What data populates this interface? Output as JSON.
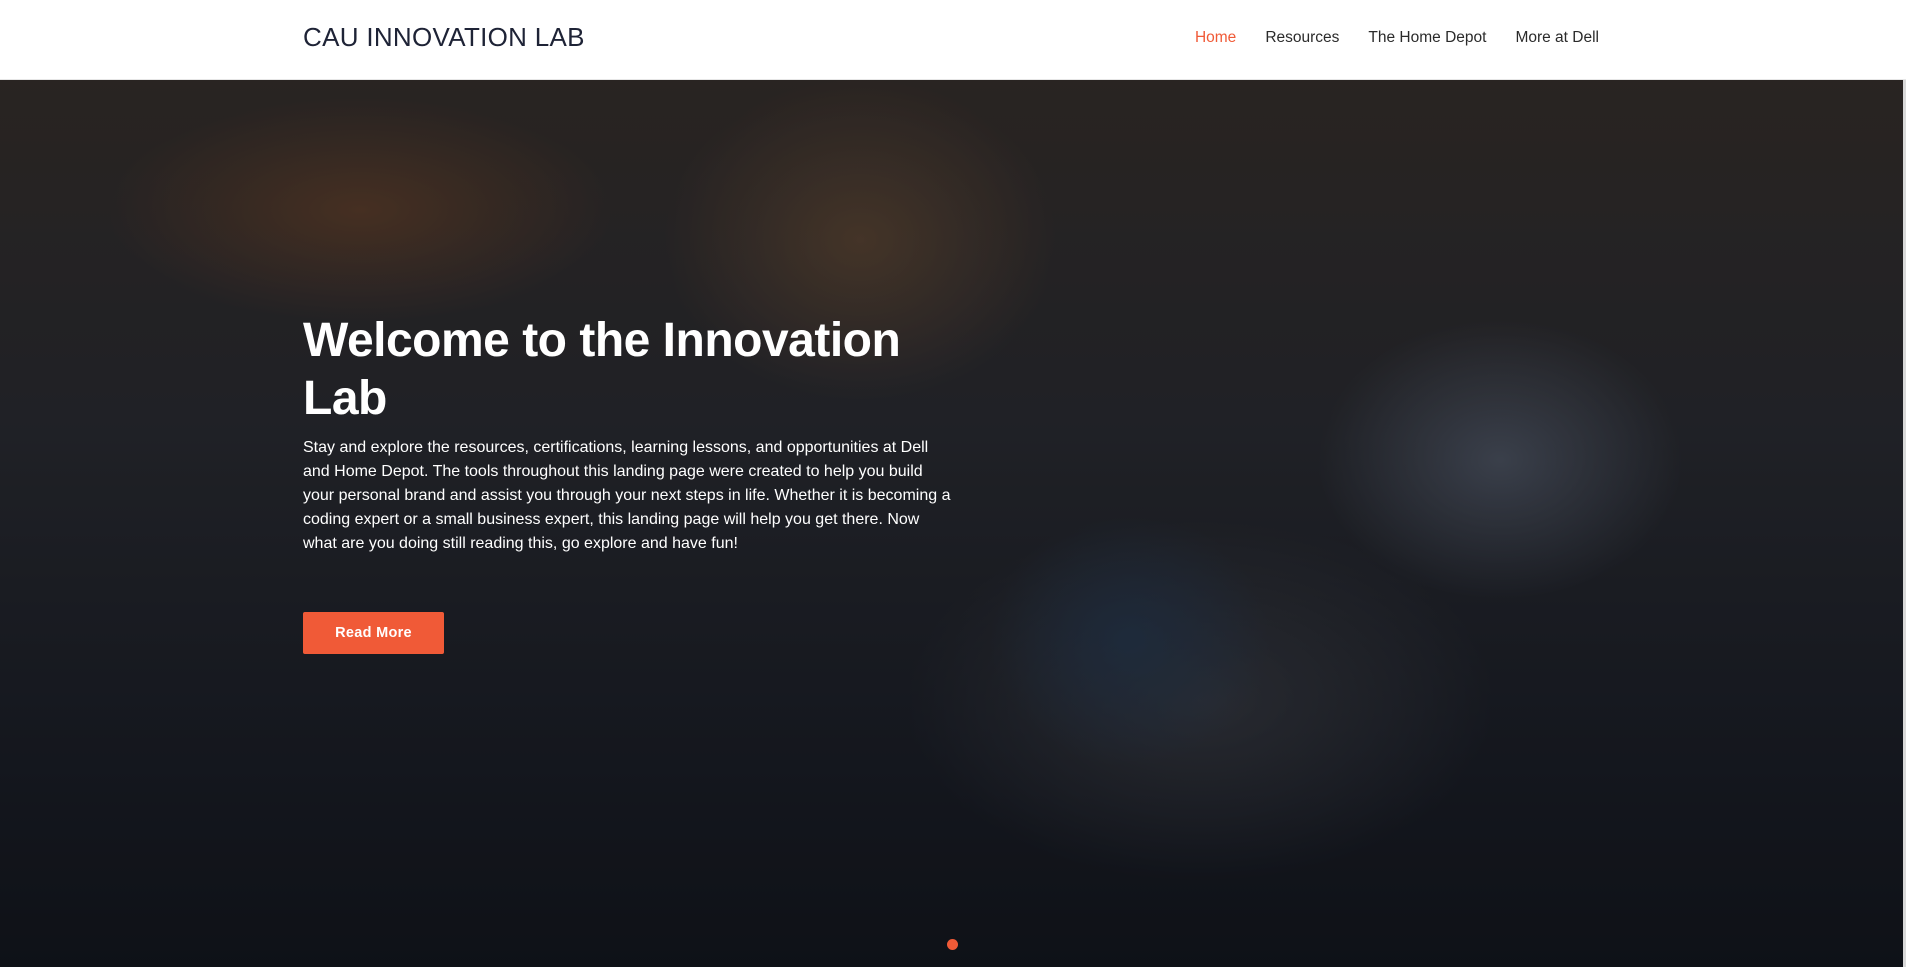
{
  "header": {
    "brand": "CAU INNOVATION LAB",
    "nav": [
      {
        "label": "Home",
        "active": true
      },
      {
        "label": "Resources",
        "active": false
      },
      {
        "label": "The Home Depot",
        "active": false
      },
      {
        "label": "More at Dell",
        "active": false
      }
    ]
  },
  "hero": {
    "title": "Welcome to the Innovation Lab",
    "description": "Stay and explore the resources, certifications, learning lessons, and opportunities at Dell and Home Depot. The tools throughout this landing page were created to help you build your personal brand and assist you through your next steps in life. Whether it is becoming a coding expert or a small business expert, this landing page will help you get there. Now what are you doing still reading this, go explore and have fun!",
    "button_label": "Read More",
    "carousel_active_index": 0
  },
  "colors": {
    "accent": "#f05a37",
    "brand_text": "#1e2336",
    "nav_text": "#2b2b2b",
    "hero_text": "#ffffff"
  }
}
